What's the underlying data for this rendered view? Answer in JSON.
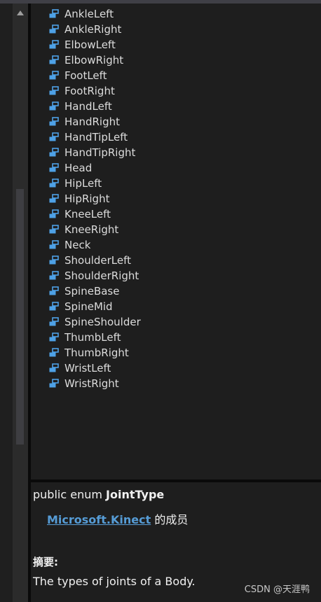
{
  "colors": {
    "background": "#1e1e1e",
    "text": "#dcdcdc",
    "link": "#569cd6",
    "icon": "#4ea1e6"
  },
  "members": [
    "AnkleLeft",
    "AnkleRight",
    "ElbowLeft",
    "ElbowRight",
    "FootLeft",
    "FootRight",
    "HandLeft",
    "HandRight",
    "HandTipLeft",
    "HandTipRight",
    "Head",
    "HipLeft",
    "HipRight",
    "KneeLeft",
    "KneeRight",
    "Neck",
    "ShoulderLeft",
    "ShoulderRight",
    "SpineBase",
    "SpineMid",
    "SpineShoulder",
    "ThumbLeft",
    "ThumbRight",
    "WristLeft",
    "WristRight"
  ],
  "member_icon": "enum-member-icon",
  "details": {
    "signature_prefix": "public enum ",
    "type_name": "JointType",
    "namespace_link": "Microsoft.Kinect",
    "member_of_suffix": " 的成员",
    "summary_label": "摘要:",
    "summary_text": "The types of joints of a Body."
  },
  "watermark": "CSDN @天涯鸭"
}
